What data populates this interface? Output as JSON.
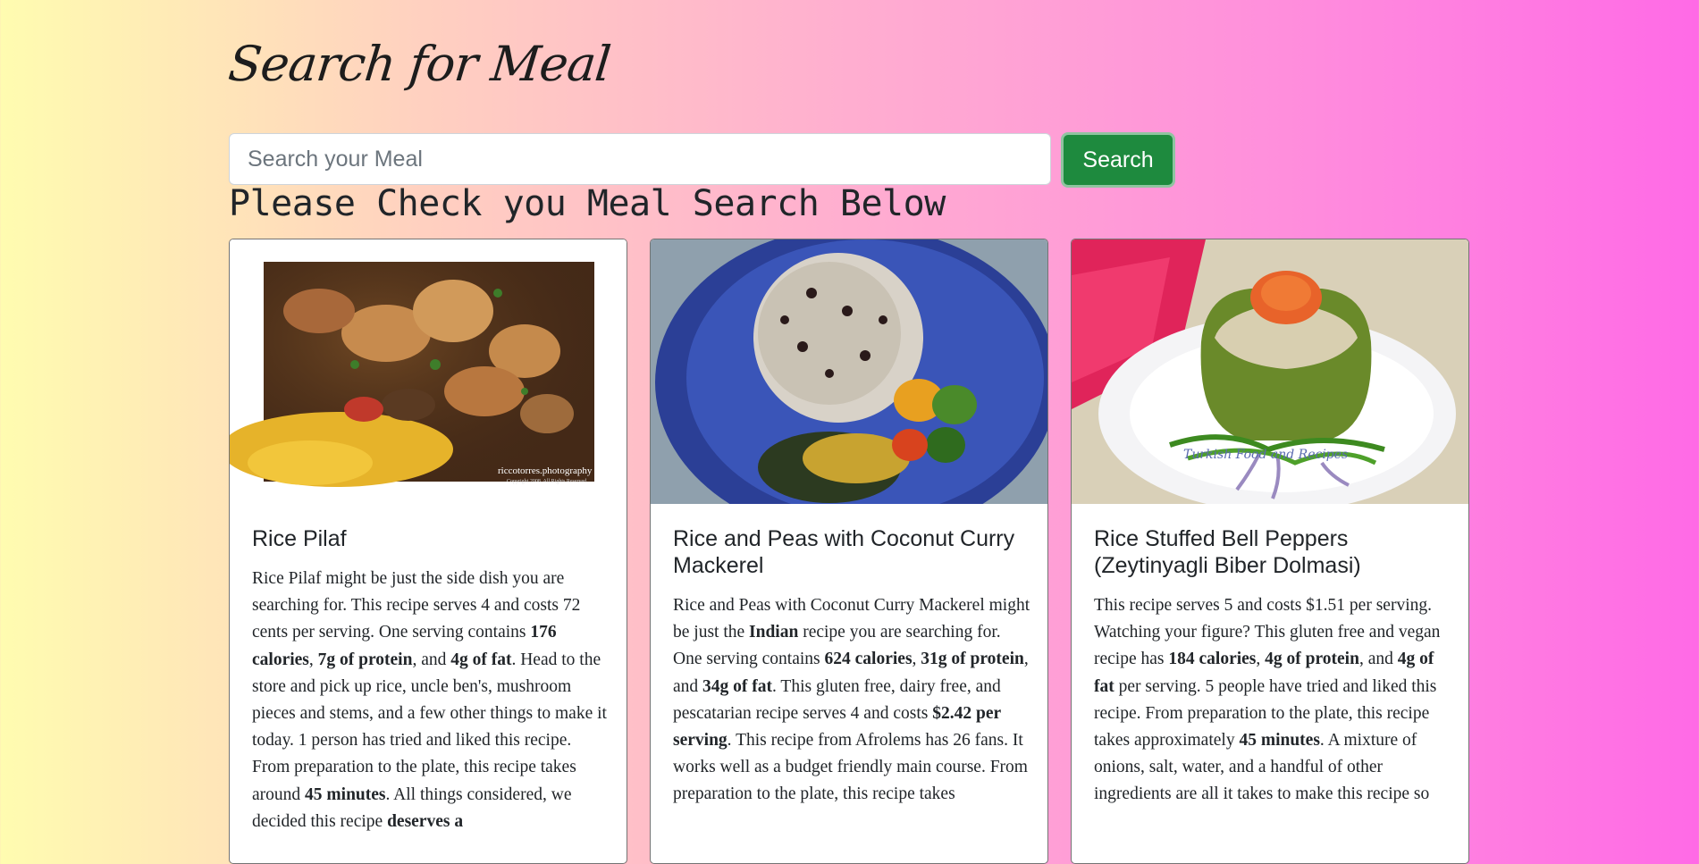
{
  "page": {
    "title": "Search for Meal",
    "search_placeholder": "Search your Meal",
    "search_value": "",
    "search_button": "Search",
    "results_heading": "Please Check you Meal Search Below"
  },
  "colors": {
    "search_button_bg": "#1e8a3e"
  },
  "cards": [
    {
      "title": "Rice Pilaf",
      "image_watermark_1": "riccotorres.photography",
      "image_watermark_2": "Copyright 2008. All Rights Reserved",
      "s": [
        "Rice Pilaf might be just the side dish you are searching for. This recipe serves 4 and costs 72 cents per serving. One serving contains ",
        "176 calories",
        ", ",
        "7g of protein",
        ", and ",
        "4g of fat",
        ". Head to the store and pick up rice, uncle ben's, mushroom pieces and stems, and a few other things to make it today. 1 person has tried and liked this recipe. From preparation to the plate, this recipe takes around ",
        "45 minutes",
        ". All things considered, we decided this recipe ",
        "deserves a"
      ]
    },
    {
      "title": "Rice and Peas with Coconut Curry Mackerel",
      "s": [
        "Rice and Peas with Coconut Curry Mackerel might be just the ",
        "Indian",
        " recipe you are searching for. One serving contains ",
        "624 calories",
        ", ",
        "31g of protein",
        ", and ",
        "34g of fat",
        ". This gluten free, dairy free, and pescatarian recipe serves 4 and costs ",
        "$2.42 per serving",
        ". This recipe from Afrolems has 26 fans. It works well as a budget friendly main course. From preparation to the plate, this recipe takes"
      ]
    },
    {
      "title": "Rice Stuffed Bell Peppers (Zeytinyagli Biber Dolmasi)",
      "image_watermark_1": "Turkish Food and Recipes",
      "s": [
        "This recipe serves 5 and costs $1.51 per serving. Watching your figure? This gluten free and vegan recipe has ",
        "184 calories",
        ", ",
        "4g of protein",
        ", and ",
        "4g of fat",
        " per serving. 5 people have tried and liked this recipe. From preparation to the plate, this recipe takes approximately ",
        "45 minutes",
        ". A mixture of onions, salt, water, and a handful of other ingredients are all it takes to make this recipe so"
      ]
    }
  ]
}
